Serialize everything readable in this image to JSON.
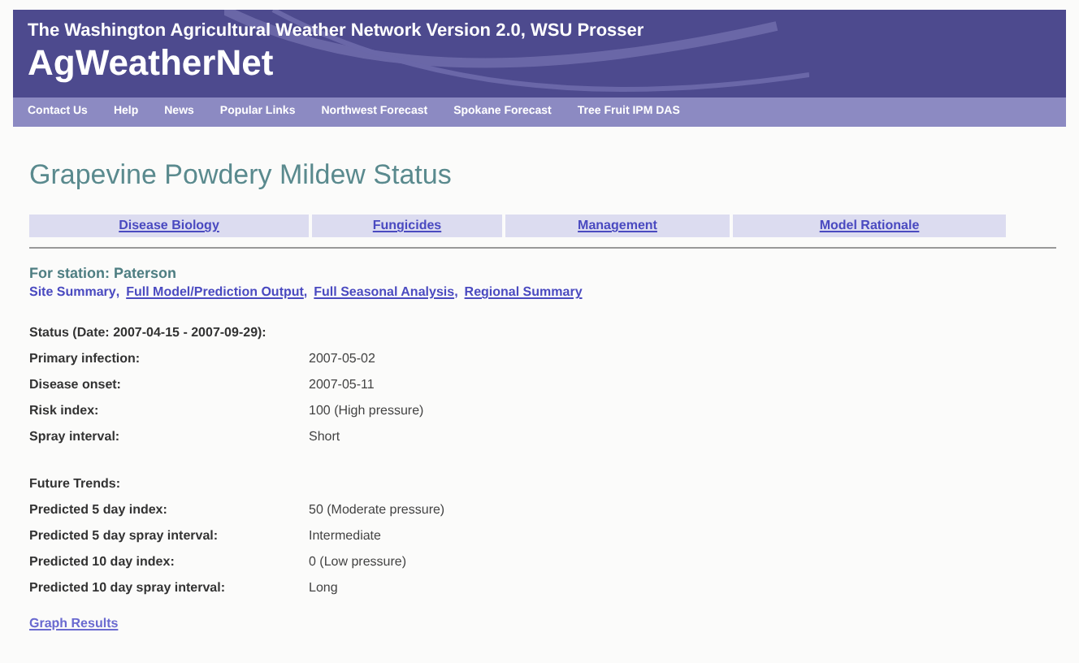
{
  "header": {
    "subtitle": "The Washington Agricultural Weather Network Version 2.0, WSU Prosser",
    "logo": "AgWeatherNet"
  },
  "nav": [
    "Contact Us",
    "Help",
    "News",
    "Popular Links",
    "Northwest Forecast",
    "Spokane Forecast",
    "Tree Fruit IPM DAS"
  ],
  "page_title": "Grapevine Powdery Mildew Status",
  "tabs": [
    "Disease Biology",
    "Fungicides",
    "Management",
    "Model Rationale"
  ],
  "station": "For station: Paterson",
  "links": [
    {
      "label": "Site Summary",
      "separator": ",",
      "selected": true
    },
    {
      "label": "Full Model/Prediction Output",
      "separator": ",",
      "selected": false
    },
    {
      "label": "Full Seasonal Analysis",
      "separator": ",",
      "selected": false
    },
    {
      "label": "Regional Summary",
      "selected": false
    }
  ],
  "sections": [
    {
      "heading": "Status (Date: 2007-04-15 - 2007-09-29):",
      "rows": [
        {
          "label": "Primary infection:",
          "value": "2007-05-02"
        },
        {
          "label": "Disease onset:",
          "value": "2007-05-11"
        },
        {
          "label": "Risk index:",
          "value": "100 (High pressure)"
        },
        {
          "label": "Spray interval:",
          "value": "Short"
        }
      ]
    },
    {
      "heading": "Future Trends:",
      "rows": [
        {
          "label": "Predicted 5 day index:",
          "value": "50 (Moderate pressure)"
        },
        {
          "label": "Predicted 5 day spray interval:",
          "value": "Intermediate"
        },
        {
          "label": "Predicted 10 day index:",
          "value": "0 (Low pressure)"
        },
        {
          "label": "Predicted 10 day spray interval:",
          "value": "Long"
        }
      ]
    }
  ],
  "graph_link": "Graph Results"
}
